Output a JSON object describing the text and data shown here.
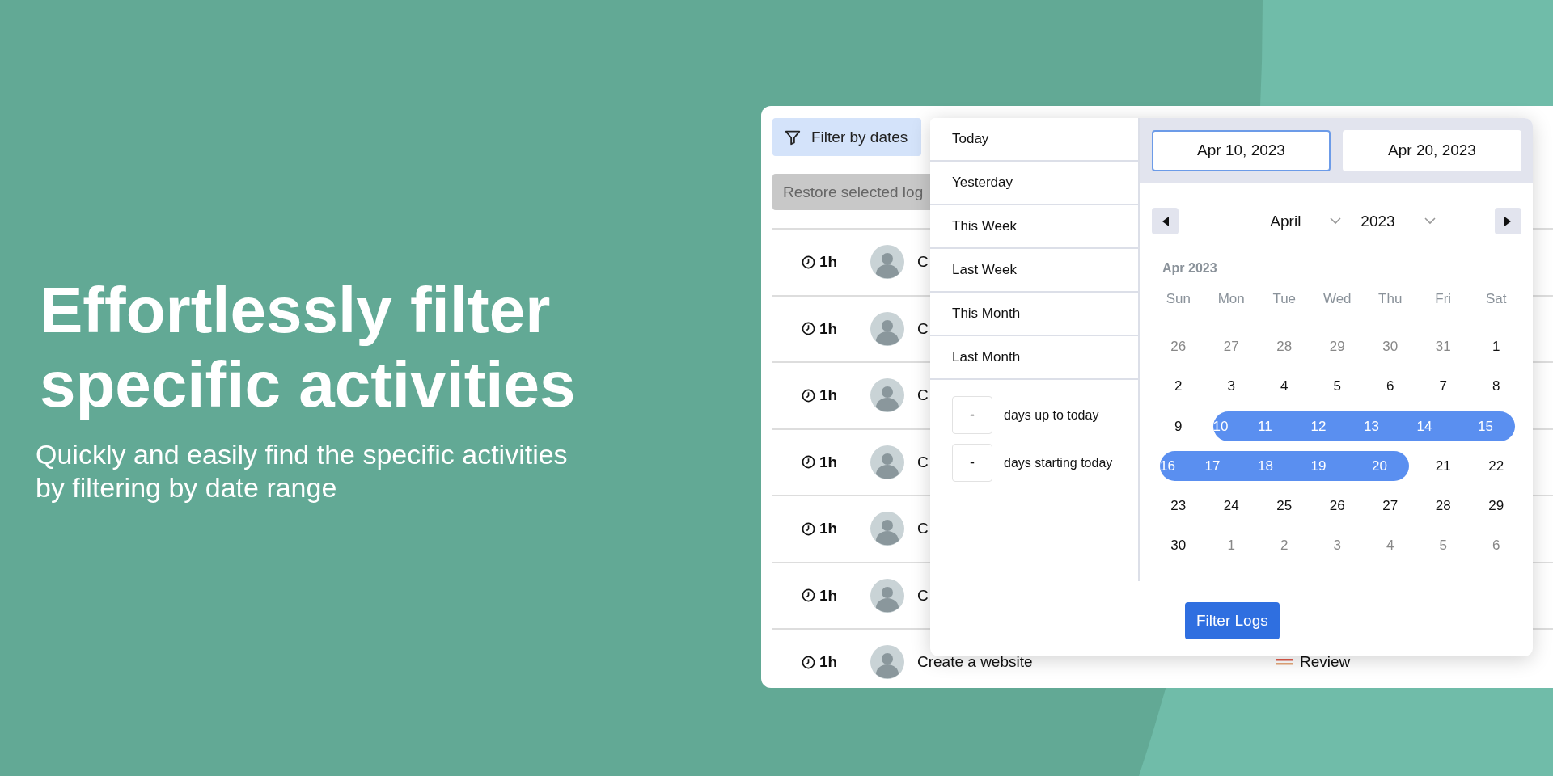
{
  "hero": {
    "title": "Effortlessly filter specific activities",
    "subtitle": "Quickly and easily find the specific activities by filtering by date range"
  },
  "toolbar": {
    "filter_button": "Filter by dates",
    "restore_button": "Restore selected log"
  },
  "rows": [
    {
      "duration": "1h",
      "title": "C"
    },
    {
      "duration": "1h",
      "title": "C"
    },
    {
      "duration": "1h",
      "title": "C"
    },
    {
      "duration": "1h",
      "title": "C"
    },
    {
      "duration": "1h",
      "title": "C"
    },
    {
      "duration": "1h",
      "title": "C"
    },
    {
      "duration": "1h",
      "title": "Create a website",
      "status": "Review"
    }
  ],
  "date_picker": {
    "presets": [
      {
        "label": "Today",
        "selected": false
      },
      {
        "label": "Yesterday",
        "selected": false
      },
      {
        "label": "This Week",
        "selected": false
      },
      {
        "label": "Last Week",
        "selected": false
      },
      {
        "label": "This Month",
        "selected": false
      },
      {
        "label": "Last Month",
        "selected": false
      }
    ],
    "relative": [
      {
        "value": "-",
        "label": "days up to today"
      },
      {
        "value": "-",
        "label": "days starting today"
      }
    ],
    "start_date": {
      "value": "Apr 10, 2023",
      "focused": true
    },
    "end_date": {
      "value": "Apr 20, 2023",
      "focused": false
    },
    "month_select": "April",
    "year_select": "2023",
    "month_heading": "Apr 2023",
    "weekdays": [
      "Sun",
      "Mon",
      "Tue",
      "Wed",
      "Thu",
      "Fri",
      "Sat"
    ],
    "weeks": [
      [
        {
          "day": "26",
          "outside": true,
          "selected": false
        },
        {
          "day": "27",
          "outside": true,
          "selected": false
        },
        {
          "day": "28",
          "outside": true,
          "selected": false
        },
        {
          "day": "29",
          "outside": true,
          "selected": false
        },
        {
          "day": "30",
          "outside": true,
          "selected": false
        },
        {
          "day": "31",
          "outside": true,
          "selected": false
        },
        {
          "day": "1",
          "outside": false,
          "selected": false
        }
      ],
      [
        {
          "day": "2",
          "outside": false,
          "selected": false
        },
        {
          "day": "3",
          "outside": false,
          "selected": false
        },
        {
          "day": "4",
          "outside": false,
          "selected": false
        },
        {
          "day": "5",
          "outside": false,
          "selected": false
        },
        {
          "day": "6",
          "outside": false,
          "selected": false
        },
        {
          "day": "7",
          "outside": false,
          "selected": false
        },
        {
          "day": "8",
          "outside": false,
          "selected": false
        }
      ],
      [
        {
          "day": "9",
          "outside": false,
          "selected": false
        },
        {
          "day": "10",
          "outside": false,
          "selected": true
        },
        {
          "day": "11",
          "outside": false,
          "selected": true
        },
        {
          "day": "12",
          "outside": false,
          "selected": true
        },
        {
          "day": "13",
          "outside": false,
          "selected": true
        },
        {
          "day": "14",
          "outside": false,
          "selected": true
        },
        {
          "day": "15",
          "outside": false,
          "selected": true
        }
      ],
      [
        {
          "day": "16",
          "outside": false,
          "selected": true
        },
        {
          "day": "17",
          "outside": false,
          "selected": true
        },
        {
          "day": "18",
          "outside": false,
          "selected": true
        },
        {
          "day": "19",
          "outside": false,
          "selected": true
        },
        {
          "day": "20",
          "outside": false,
          "selected": true
        },
        {
          "day": "21",
          "outside": false,
          "selected": false
        },
        {
          "day": "22",
          "outside": false,
          "selected": false
        }
      ],
      [
        {
          "day": "23",
          "outside": false,
          "selected": false
        },
        {
          "day": "24",
          "outside": false,
          "selected": false
        },
        {
          "day": "25",
          "outside": false,
          "selected": false
        },
        {
          "day": "26",
          "outside": false,
          "selected": false
        },
        {
          "day": "27",
          "outside": false,
          "selected": false
        },
        {
          "day": "28",
          "outside": false,
          "selected": false
        },
        {
          "day": "29",
          "outside": false,
          "selected": false
        }
      ],
      [
        {
          "day": "30",
          "outside": false,
          "selected": false
        },
        {
          "day": "1",
          "outside": true,
          "selected": false
        },
        {
          "day": "2",
          "outside": true,
          "selected": false
        },
        {
          "day": "3",
          "outside": true,
          "selected": false
        },
        {
          "day": "4",
          "outside": true,
          "selected": false
        },
        {
          "day": "5",
          "outside": true,
          "selected": false
        },
        {
          "day": "6",
          "outside": true,
          "selected": false
        }
      ]
    ],
    "apply_button": "Filter Logs"
  }
}
